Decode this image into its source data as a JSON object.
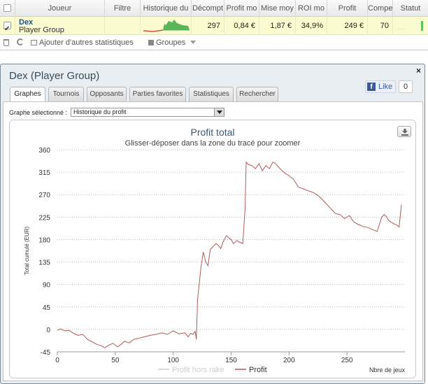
{
  "table": {
    "headers": [
      "Joueur",
      "Filtre",
      "Historique du",
      "Décompt",
      "Profit mo",
      "Mise moy",
      "ROI mo",
      "Profit",
      "Compe",
      "Statut"
    ],
    "row": {
      "player_name": "Dex",
      "player_group": "Player Group",
      "decompte": "297",
      "profit_moyen": "0,84 €",
      "mise_moyenne": "1,87 €",
      "roi_moyen": "34,9%",
      "profit": "249 €",
      "competence": "70",
      "statut_text": "...."
    }
  },
  "toolbar": {
    "add_stats_label": "Ajouter d'autres statistiques",
    "groups_label": "Groupes"
  },
  "dialog": {
    "title": "Dex (Player Group)",
    "close_label": "×",
    "fb_like_label": "Like",
    "fb_count": "0",
    "tabs": [
      {
        "label": "Graphes",
        "active": true
      },
      {
        "label": "Tournois",
        "active": false
      },
      {
        "label": "Opposants",
        "active": false
      },
      {
        "label": "Parties favorites",
        "active": false
      },
      {
        "label": "Statistiques",
        "active": false
      },
      {
        "label": "Rechercher",
        "active": false
      }
    ],
    "select_label": "Graphe sélectionné :",
    "select_value": "Historique du profit"
  },
  "chart_data": {
    "type": "line",
    "title": "Profit total",
    "subtitle": "Glisser-déposer dans la zone du tracé pour zoomer",
    "ylabel": "Total cumulé (EUR)",
    "xlabel": "Nbre de jeux",
    "xlim": [
      0,
      300
    ],
    "ylim": [
      -45,
      360
    ],
    "xticks": [
      0,
      50,
      100,
      150,
      200,
      250
    ],
    "yticks": [
      -45,
      0,
      45,
      90,
      135,
      180,
      225,
      270,
      315,
      360
    ],
    "grid": true,
    "legend_position": "bottom-center",
    "series": [
      {
        "name": "Profit hors rake",
        "color": "#cccccc",
        "visible": false,
        "x": [],
        "y": []
      },
      {
        "name": "Profit",
        "color": "#b05a5a",
        "visible": true,
        "x": [
          0,
          3,
          6,
          10,
          14,
          18,
          22,
          26,
          30,
          34,
          38,
          41,
          44,
          48,
          52,
          55,
          58,
          62,
          66,
          70,
          75,
          80,
          85,
          90,
          95,
          100,
          105,
          110,
          113,
          115,
          117,
          119,
          120,
          121,
          122,
          124,
          126,
          128,
          130,
          132,
          134,
          137,
          139,
          141,
          143,
          146,
          148,
          150,
          152,
          155,
          157,
          160,
          162,
          163,
          165,
          168,
          171,
          174,
          177,
          180,
          183,
          186,
          188,
          191,
          194,
          197,
          200,
          204,
          208,
          212,
          216,
          220,
          224,
          228,
          232,
          236,
          240,
          244,
          248,
          252,
          256,
          260,
          264,
          268,
          272,
          276,
          280,
          282,
          284,
          286,
          290,
          293,
          295,
          297
        ],
        "y": [
          -2,
          1,
          -3,
          -2,
          -8,
          -12,
          -10,
          -20,
          -25,
          -30,
          -33,
          -37,
          -32,
          -28,
          -35,
          -30,
          -24,
          -27,
          -20,
          -18,
          -15,
          -12,
          -10,
          -7,
          -10,
          -3,
          -9,
          -7,
          -15,
          -8,
          -10,
          -4,
          -20,
          60,
          80,
          125,
          155,
          135,
          128,
          160,
          165,
          172,
          168,
          162,
          175,
          188,
          183,
          180,
          172,
          178,
          175,
          172,
          240,
          335,
          330,
          328,
          322,
          332,
          318,
          328,
          322,
          335,
          333,
          325,
          318,
          312,
          308,
          300,
          285,
          282,
          278,
          275,
          270,
          262,
          252,
          242,
          232,
          230,
          222,
          228,
          215,
          210,
          206,
          204,
          200,
          196,
          225,
          230,
          226,
          218,
          212,
          209,
          205,
          250
        ]
      }
    ]
  }
}
